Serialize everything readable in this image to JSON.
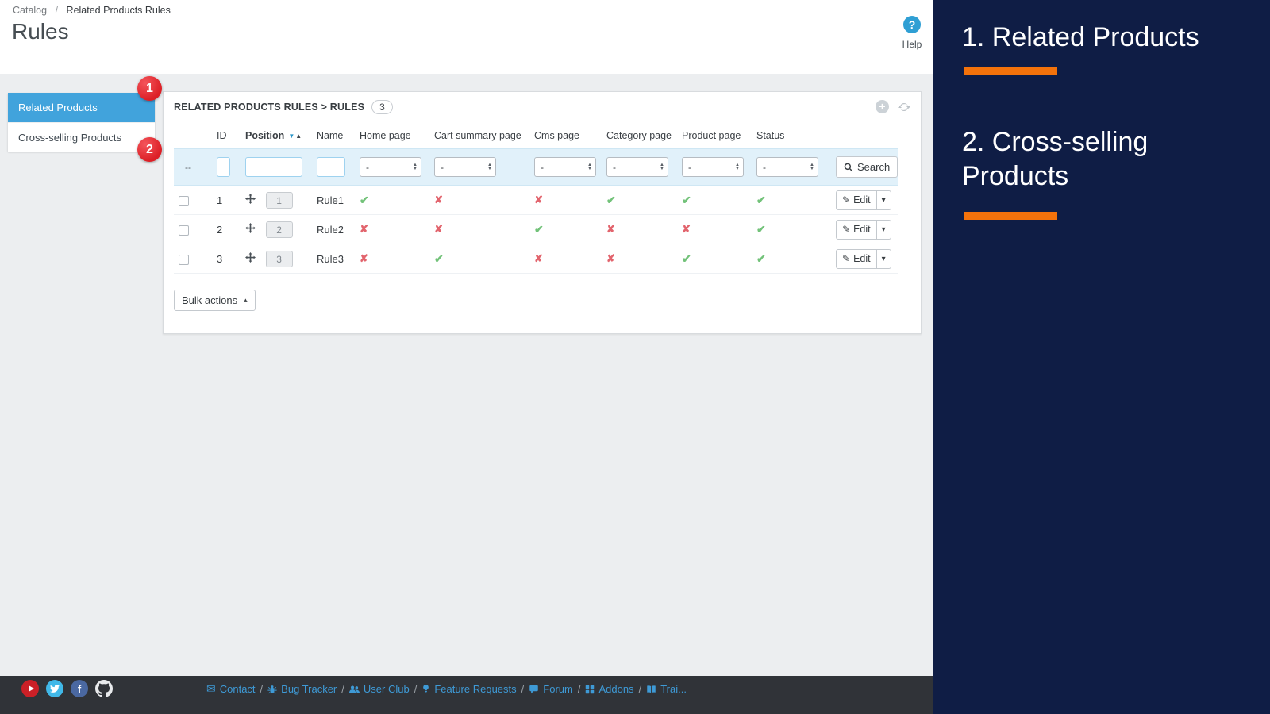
{
  "colors": {
    "tab_active_blue": "#41a3dc",
    "badge_red": "#dc1f26",
    "check_green": "#72c279",
    "cross_red": "#e2646d",
    "overlay_navy": "#0f1d45",
    "overlay_orange": "#f3720b",
    "footer_link_blue": "#3e9ad6",
    "help_blue": "#2f9fd4"
  },
  "icons": {
    "question": "?",
    "plus": "+",
    "sort_desc": "▼",
    "sort_asc": "▲",
    "stepper_up": "▲",
    "stepper_down": "▼",
    "caret_down": "▾",
    "caret_up": "▴",
    "pencil": "✎",
    "check": "✔",
    "cross": "✘",
    "envelope": "✉"
  },
  "breadcrumb": {
    "parent": "Catalog",
    "separator": "/",
    "current": "Related Products Rules"
  },
  "page_title": "Rules",
  "help": {
    "label": "Help"
  },
  "sidebar": {
    "tabs": [
      {
        "label": "Related Products",
        "badge": "1",
        "active": true
      },
      {
        "label": "Cross-selling Products",
        "badge": "2",
        "active": false
      }
    ]
  },
  "panel": {
    "title": "RELATED PRODUCTS RULES > RULES",
    "count": "3"
  },
  "table": {
    "columns": {
      "id": "ID",
      "position": "Position",
      "name": "Name",
      "home": "Home page",
      "cart": "Cart summary page",
      "cms": "Cms page",
      "category": "Category page",
      "product": "Product page",
      "status": "Status"
    },
    "filter": {
      "checkbox_placeholder": "--",
      "select_placeholder": "-",
      "search_label": "Search"
    },
    "rows": [
      {
        "id": "1",
        "position": "1",
        "name": "Rule1",
        "flags": [
          true,
          false,
          false,
          true,
          true,
          true
        ]
      },
      {
        "id": "2",
        "position": "2",
        "name": "Rule2",
        "flags": [
          false,
          false,
          true,
          false,
          false,
          true
        ]
      },
      {
        "id": "3",
        "position": "3",
        "name": "Rule3",
        "flags": [
          false,
          true,
          false,
          false,
          true,
          true
        ]
      }
    ],
    "actions": {
      "edit_label": "Edit"
    }
  },
  "bulk_actions_label": "Bulk actions",
  "footer": {
    "separator": "/",
    "social": [
      {
        "name": "youtube"
      },
      {
        "name": "twitter"
      },
      {
        "name": "facebook"
      },
      {
        "name": "github"
      }
    ],
    "links": [
      {
        "label": "Contact"
      },
      {
        "label": "Bug Tracker"
      },
      {
        "label": "User Club"
      },
      {
        "label": "Feature Requests"
      },
      {
        "label": "Forum"
      },
      {
        "label": "Addons"
      },
      {
        "label": "Trai..."
      }
    ]
  },
  "overlay": {
    "items": [
      {
        "text": "1. Related Products"
      },
      {
        "text": "2. Cross-selling Products"
      }
    ]
  }
}
